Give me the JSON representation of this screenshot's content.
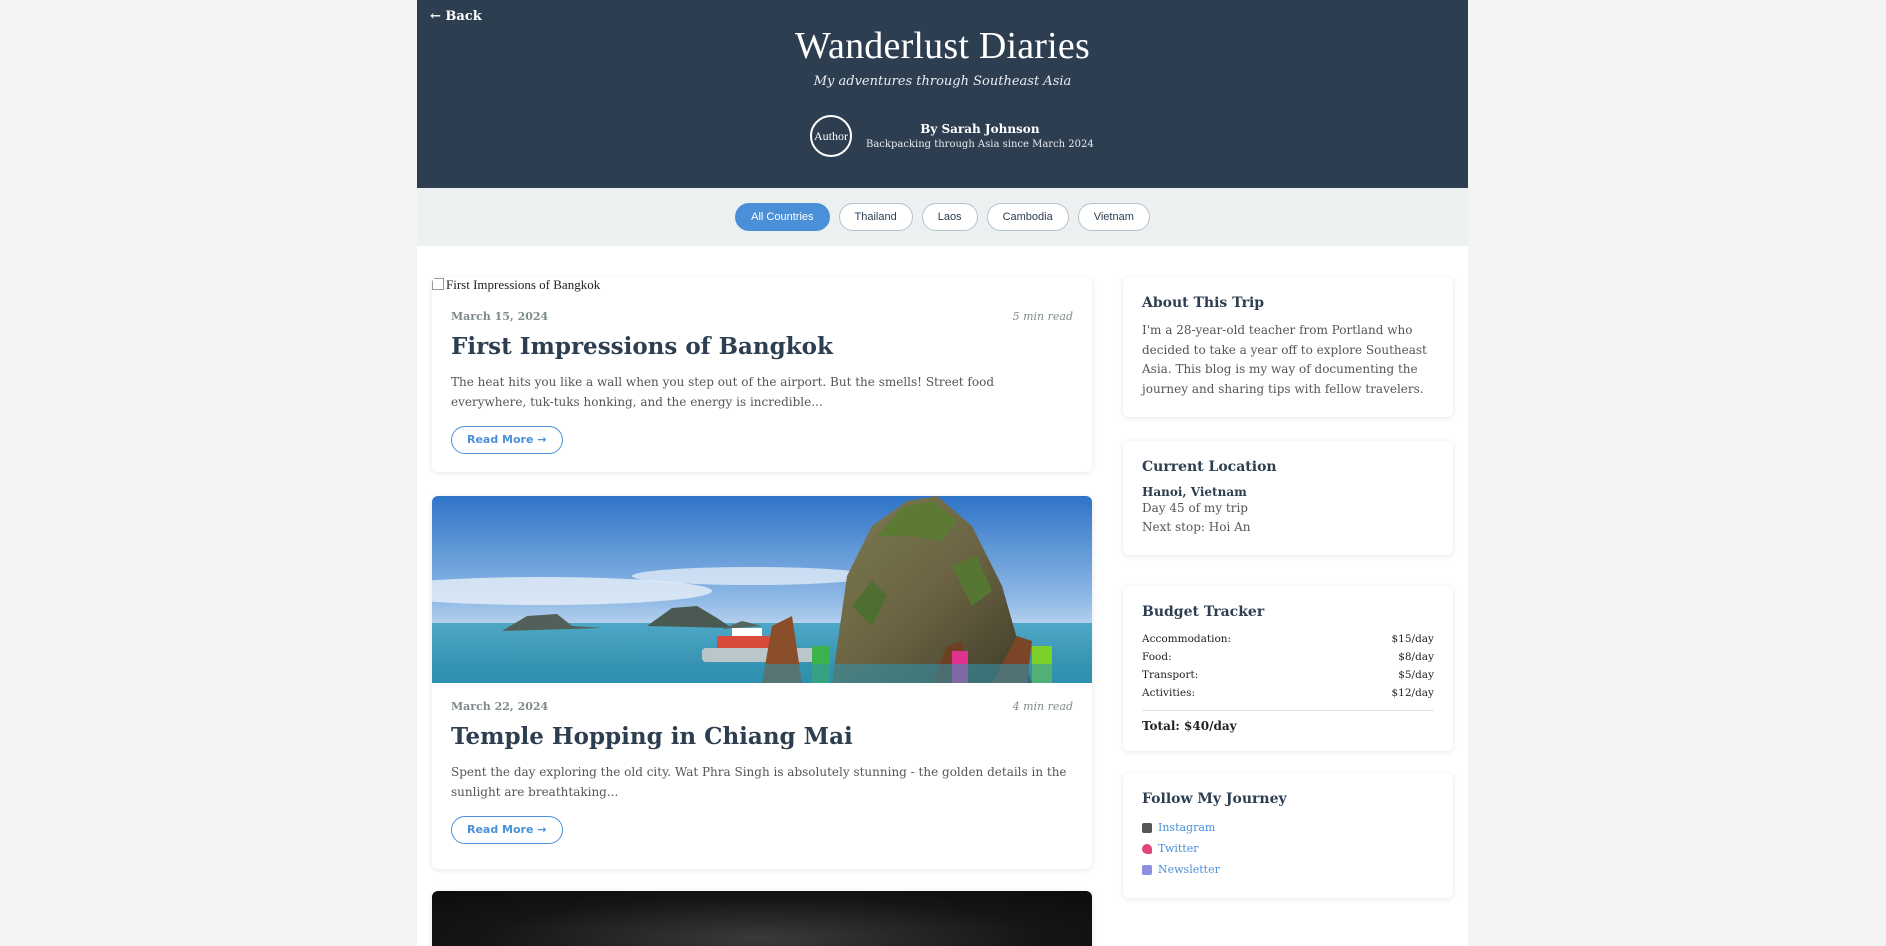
{
  "header": {
    "back_label": "← Back",
    "title": "Wanderlust Diaries",
    "tagline": "My adventures through Southeast Asia",
    "avatar_alt": "Author",
    "author_name": "By Sarah Johnson",
    "author_bio": "Backpacking through Asia since March 2024"
  },
  "filters": [
    {
      "label": "All Countries",
      "active": true
    },
    {
      "label": "Thailand",
      "active": false
    },
    {
      "label": "Laos",
      "active": false
    },
    {
      "label": "Cambodia",
      "active": false
    },
    {
      "label": "Vietnam",
      "active": false
    }
  ],
  "posts": [
    {
      "image_alt": "First Impressions of Bangkok",
      "date": "March 15, 2024",
      "read_time": "5 min read",
      "title": "First Impressions of Bangkok",
      "excerpt": "The heat hits you like a wall when you step out of the airport. But the smells! Street food everywhere, tuk-tuks honking, and the energy is incredible...",
      "read_more": "Read More →"
    },
    {
      "date": "March 22, 2024",
      "read_time": "4 min read",
      "title": "Temple Hopping in Chiang Mai",
      "excerpt": "Spent the day exploring the old city. Wat Phra Singh is absolutely stunning - the golden details in the sunlight are breathtaking...",
      "read_more": "Read More →"
    }
  ],
  "sidebar": {
    "about": {
      "title": "About This Trip",
      "text": "I'm a 28-year-old teacher from Portland who decided to take a year off to explore Southeast Asia. This blog is my way of documenting the journey and sharing tips with fellow travelers."
    },
    "location": {
      "title": "Current Location",
      "city": "Hanoi, Vietnam",
      "day": "Day 45 of my trip",
      "next": "Next stop: Hoi An"
    },
    "budget": {
      "title": "Budget Tracker",
      "rows": [
        {
          "label": "Accommodation:",
          "value": "$15/day"
        },
        {
          "label": "Food:",
          "value": "$8/day"
        },
        {
          "label": "Transport:",
          "value": "$5/day"
        },
        {
          "label": "Activities:",
          "value": "$12/day"
        }
      ],
      "total": "Total: $40/day"
    },
    "follow": {
      "title": "Follow My Journey",
      "links": [
        {
          "label": "Instagram",
          "icon": "camera-icon"
        },
        {
          "label": "Twitter",
          "icon": "bird-icon"
        },
        {
          "label": "Newsletter",
          "icon": "envelope-icon"
        }
      ]
    }
  },
  "colors": {
    "header_bg": "#2c3e50",
    "accent": "#4a90d9",
    "filter_bar_bg": "#ecf0f1"
  }
}
